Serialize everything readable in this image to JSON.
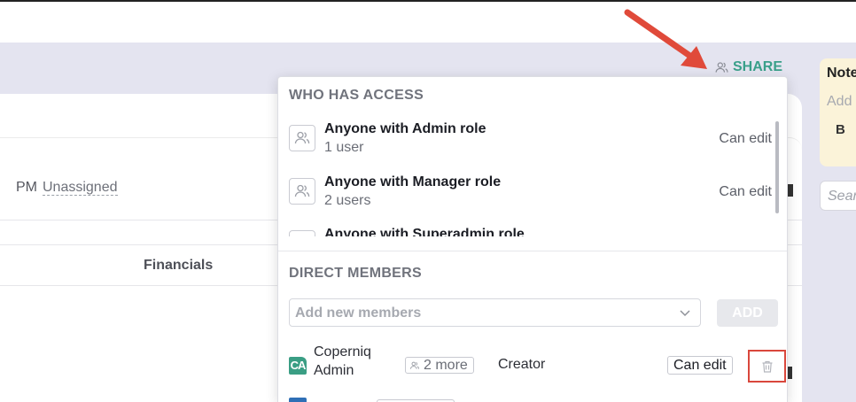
{
  "header": {
    "share_label": "SHARE"
  },
  "background": {
    "pm_label": "PM",
    "pm_value": "Unassigned",
    "financials_tab": "Financials",
    "notes_title": "Notes",
    "notes_placeholder": "Add",
    "notes_bold_btn": "B",
    "search_placeholder": "Search"
  },
  "share_popup": {
    "who_has_access_title": "WHO HAS ACCESS",
    "access_entries": [
      {
        "name": "Anyone with Admin role",
        "count": "1 user",
        "permission": "Can edit"
      },
      {
        "name": "Anyone with Manager role",
        "count": "2 users",
        "permission": "Can edit"
      },
      {
        "name": "Anyone with Superadmin role",
        "count": "",
        "permission": ""
      }
    ],
    "direct_members_title": "DIRECT MEMBERS",
    "add_members_placeholder": "Add new members",
    "add_button_label": "ADD",
    "members": [
      {
        "initials": "CA",
        "name_line1": "Coperniq",
        "name_line2": "Admin",
        "more_label": "2 more",
        "role": "Creator",
        "permission": "Can edit"
      }
    ]
  },
  "colors": {
    "accent": "#3aa08a",
    "highlight_border": "#d9473c",
    "annotation_arrow": "#e04a3a",
    "background_band": "#e4e4f0"
  },
  "icons": [
    "users-icon",
    "chevron-down-icon",
    "trash-icon",
    "annotation-arrow"
  ]
}
